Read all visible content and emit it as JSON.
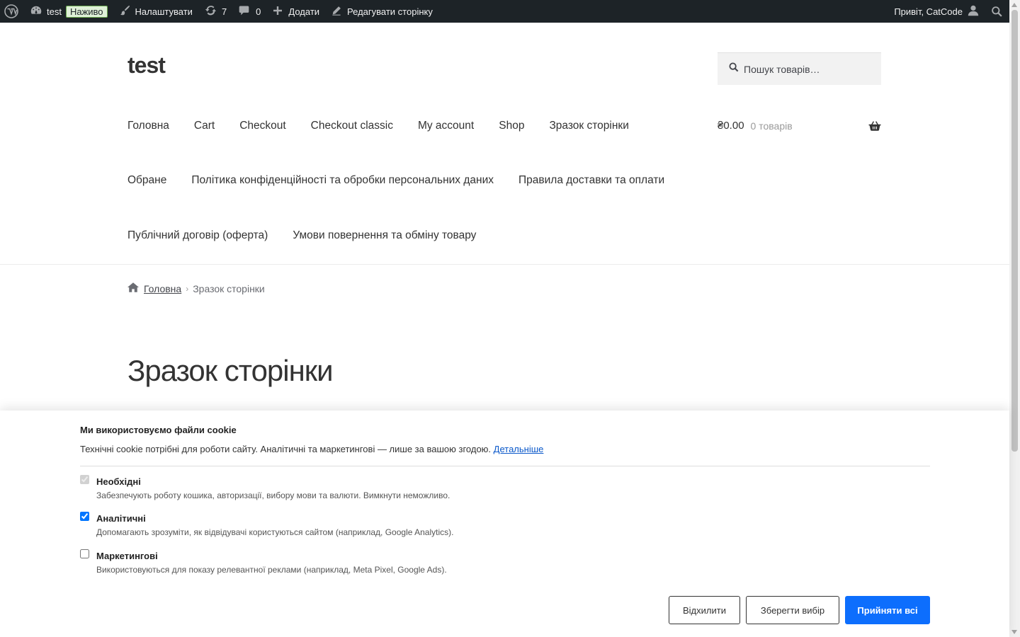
{
  "admin_bar": {
    "site_name": "test",
    "live_badge": "Наживо",
    "customize": "Налаштувати",
    "updates_count": "7",
    "comments_count": "0",
    "new_label": "Додати",
    "edit_page": "Редагувати сторінку",
    "greeting": "Привіт, CatCode"
  },
  "header": {
    "site_title": "test",
    "search_placeholder": "Пошук товарів…"
  },
  "nav": {
    "row1": [
      "Головна",
      "Cart",
      "Checkout",
      "Checkout classic",
      "My account",
      "Shop",
      "Зразок сторінки"
    ],
    "row2": [
      "Обране",
      "Політика конфіденційності та обробки персональних даних",
      "Правила доставки та оплати"
    ],
    "row3": [
      "Публічний договір (оферта)",
      "Умови повернення та обміну товару"
    ]
  },
  "cart": {
    "total": "₴0.00",
    "count": "0 товарів"
  },
  "breadcrumb": {
    "home": "Головна",
    "current": "Зразок сторінки"
  },
  "page": {
    "title": "Зразок сторінки"
  },
  "cookie": {
    "title": "Ми використовуємо файли cookie",
    "desc": "Технічні cookie потрібні для роботи сайту. Аналітичні та маркетингові — лише за вашою згодою.",
    "details_link": "Детальніше",
    "options": [
      {
        "label": "Необхідні",
        "note": "Забезпечують роботу кошика, авторизації, вибору мови та валюти. Вимкнути неможливо.",
        "checked": true,
        "disabled": true
      },
      {
        "label": "Аналітичні",
        "note": "Допомагають зрозуміти, як відвідувачі користуються сайтом (наприклад, Google Analytics).",
        "checked": true,
        "disabled": false
      },
      {
        "label": "Маркетингові",
        "note": "Використовуються для показу релевантної реклами (наприклад, Meta Pixel, Google Ads).",
        "checked": false,
        "disabled": false
      }
    ],
    "buttons": {
      "reject": "Відхилити",
      "save": "Зберегти вибір",
      "accept": "Прийняти всі"
    },
    "accent_color": "#0d6efd"
  }
}
